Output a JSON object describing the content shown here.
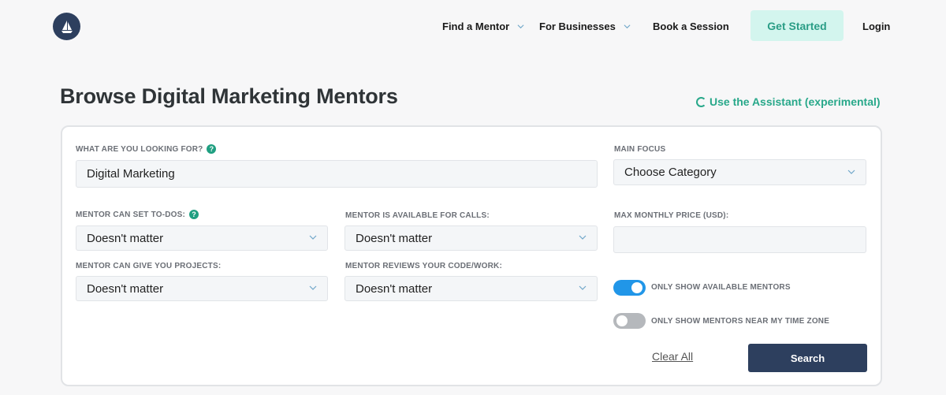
{
  "header": {
    "nav": [
      {
        "label": "Find a Mentor",
        "has_dropdown": true
      },
      {
        "label": "For Businesses",
        "has_dropdown": true
      },
      {
        "label": "Book a Session",
        "has_dropdown": false
      }
    ],
    "cta_label": "Get Started",
    "login_label": "Login",
    "logo_icon": "sailboat-logo-icon"
  },
  "page": {
    "title": "Browse Digital Marketing Mentors",
    "assistant_link": "Use the Assistant (experimental)"
  },
  "form": {
    "search": {
      "label": "WHAT ARE YOU LOOKING FOR?",
      "value": "Digital Marketing"
    },
    "main_focus": {
      "label": "MAIN FOCUS",
      "value": "Choose Category"
    },
    "todos": {
      "label": "MENTOR CAN SET TO-DOS:",
      "value": "Doesn't matter"
    },
    "calls": {
      "label": "MENTOR IS AVAILABLE FOR CALLS:",
      "value": "Doesn't matter"
    },
    "max_price": {
      "label": "MAX MONTHLY PRICE (USD):",
      "value": ""
    },
    "projects": {
      "label": "MENTOR CAN GIVE YOU PROJECTS:",
      "value": "Doesn't matter"
    },
    "reviews": {
      "label": "MENTOR REVIEWS YOUR CODE/WORK:",
      "value": "Doesn't matter"
    },
    "toggle_available": {
      "label": "ONLY SHOW AVAILABLE MENTORS",
      "on": true
    },
    "toggle_timezone": {
      "label": "ONLY SHOW MENTORS NEAR MY TIME ZONE",
      "on": false
    },
    "clear_label": "Clear All",
    "search_button": "Search",
    "help_glyph": "?"
  },
  "colors": {
    "brand_navy": "#2d3f5e",
    "accent_green": "#28a88a",
    "toggle_on": "#2196e8",
    "toggle_off": "#b5b8bc"
  }
}
